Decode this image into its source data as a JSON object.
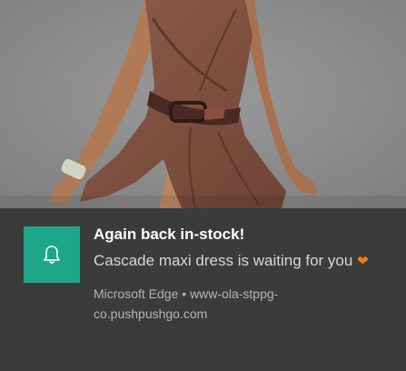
{
  "notification": {
    "title": "Again back in-stock!",
    "body": "Cascade maxi dress is waiting for you",
    "heart_icon": "orange-heart-emoji",
    "source_app": "Microsoft Edge",
    "separator": "•",
    "source_site": "www-ola-stppg-co.pushpushgo.com",
    "app_icon": "bell-icon",
    "colors": {
      "icon_bg": "#1ea68a",
      "panel_bg": "#3b3b3b",
      "heart": "#f07c1a"
    }
  }
}
